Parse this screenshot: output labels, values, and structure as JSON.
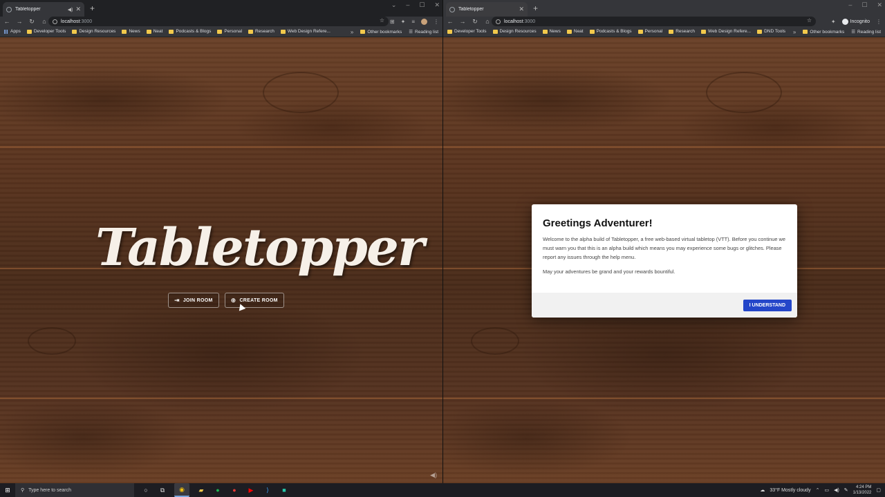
{
  "left_window": {
    "tab_title": "Tabletopper",
    "url_host": "localhost",
    "url_port": ":3000",
    "bookmarks": [
      "Apps",
      "Developer Tools",
      "Design Resources",
      "News",
      "Neat",
      "Podcasts & Blogs",
      "Personal",
      "Research",
      "Web Design Refere..."
    ],
    "other_bookmarks": "Other bookmarks",
    "reading_list": "Reading list",
    "logo": "Tabletopper",
    "join_label": "JOIN ROOM",
    "create_label": "CREATE ROOM"
  },
  "right_window": {
    "tab_title": "Tabletopper",
    "url_host": "localhost",
    "url_port": ":3000",
    "incognito_label": "Incognito",
    "bookmarks": [
      "Developer Tools",
      "Design Resources",
      "News",
      "Neat",
      "Podcasts & Blogs",
      "Personal",
      "Research",
      "Web Design Refere...",
      "DND Tools"
    ],
    "other_bookmarks": "Other bookmarks",
    "reading_list": "Reading list",
    "modal": {
      "title": "Greetings Adventurer!",
      "body1": "Welcome to the alpha build of Tabletopper, a free web-based virtual tabletop (VTT). Before you continue we must warn you that this is an alpha build which means you may experience some bugs or glitches. Please report any issues through the help menu.",
      "body2": "May your adventures be grand and your rewards bountiful.",
      "button": "I UNDERSTAND"
    }
  },
  "taskbar": {
    "search_placeholder": "Type here to search",
    "weather": "33°F  Mostly cloudy",
    "time": "4:24 PM",
    "date": "1/13/2022"
  },
  "colors": {
    "accent_button": "#2446c9",
    "chrome_dark": "#202124",
    "chrome_toolbar": "#35363a"
  }
}
